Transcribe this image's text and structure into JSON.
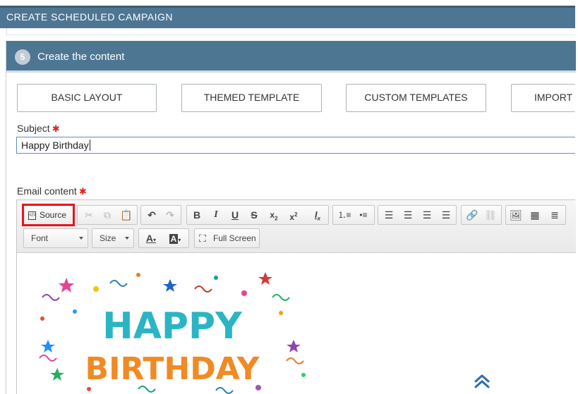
{
  "page_header": {
    "title": "CREATE SCHEDULED CAMPAIGN"
  },
  "step": {
    "number": "5",
    "title": "Create the content"
  },
  "template_buttons": [
    {
      "label": "BASIC LAYOUT"
    },
    {
      "label": "THEMED TEMPLATE"
    },
    {
      "label": "CUSTOM TEMPLATES"
    },
    {
      "label": "IMPORT I"
    }
  ],
  "subject": {
    "label": "Subject",
    "value": "Happy Birthday",
    "required_mark": "✱"
  },
  "email_content": {
    "label": "Email content",
    "required_mark": "✱"
  },
  "toolbar": {
    "source_label": "Source",
    "font_label": "Font",
    "size_label": "Size",
    "fullscreen_label": "Full Screen",
    "icons": [
      "cut-icon",
      "copy-icon",
      "paste-icon",
      "undo-icon",
      "redo-icon",
      "bold-icon",
      "italic-icon",
      "underline-icon",
      "strikethrough-icon",
      "subscript-icon",
      "superscript-icon",
      "remove-format-icon",
      "numbered-list-icon",
      "bulleted-list-icon",
      "align-left-icon",
      "align-center-icon",
      "align-right-icon",
      "justify-icon",
      "link-icon",
      "unlink-icon",
      "image-icon",
      "table-icon",
      "horizontal-rule-icon",
      "text-color-icon",
      "background-color-icon",
      "fullscreen-icon"
    ]
  },
  "content": {
    "image_line1": "HAPPY",
    "image_line2": "BIRTHDAY"
  },
  "colors": {
    "header_bg": "#4d7693",
    "input_border": "#5b8ec1",
    "highlight_red": "#e8141c",
    "required_red": "#e02020",
    "scroll_icon": "#2a6cb3"
  }
}
